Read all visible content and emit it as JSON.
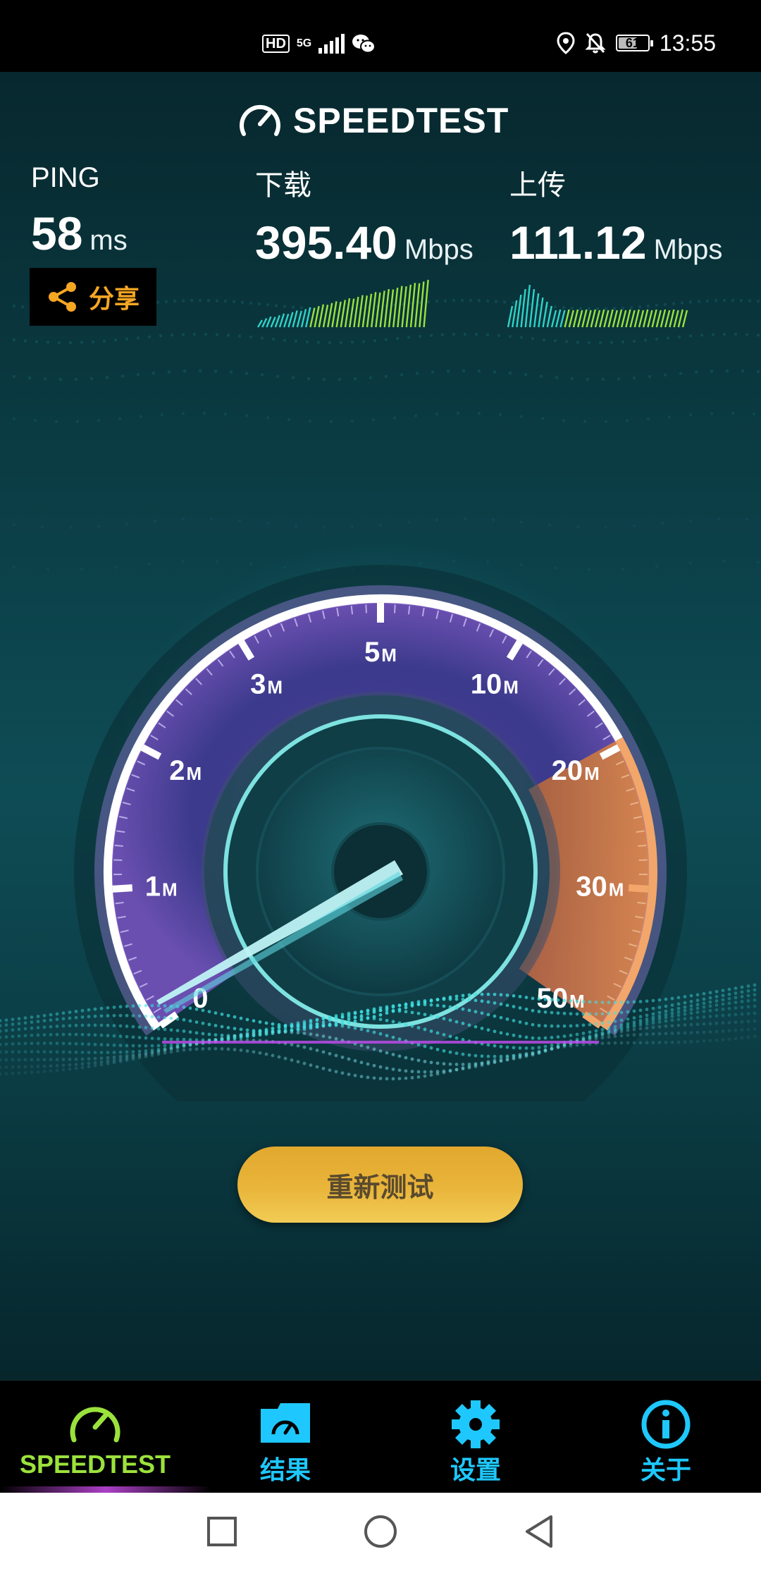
{
  "status_bar": {
    "hd": "HD",
    "network": "5G",
    "time": "13:55",
    "battery": "61"
  },
  "app": {
    "logo_text": "SPEEDTEST",
    "ping": {
      "label": "PING",
      "value": "58",
      "unit": "ms"
    },
    "download": {
      "label": "下载",
      "value": "395.40",
      "unit": "Mbps"
    },
    "upload": {
      "label": "上传",
      "value": "111.12",
      "unit": "Mbps"
    },
    "share_label": "分享",
    "gauge": {
      "labels": [
        {
          "num": "0",
          "unit": ""
        },
        {
          "num": "1",
          "unit": "M"
        },
        {
          "num": "2",
          "unit": "M"
        },
        {
          "num": "3",
          "unit": "M"
        },
        {
          "num": "5",
          "unit": "M"
        },
        {
          "num": "10",
          "unit": "M"
        },
        {
          "num": "20",
          "unit": "M"
        },
        {
          "num": "30",
          "unit": "M"
        },
        {
          "num": "50",
          "unit": "M"
        }
      ],
      "arc_color": "#ffffff",
      "face_color": "#2e3f86",
      "highlight_color": "#d9753a"
    },
    "retest_label": "重新测试"
  },
  "bottom_nav": {
    "items": [
      {
        "label": "SPEEDTEST",
        "icon": "speedometer-icon",
        "color": "#9be23c",
        "active": true
      },
      {
        "label": "结果",
        "icon": "results-folder-icon",
        "color": "#1ec8ff",
        "active": false
      },
      {
        "label": "设置",
        "icon": "gear-icon",
        "color": "#1ec8ff",
        "active": false
      },
      {
        "label": "关于",
        "icon": "info-icon",
        "color": "#1ec8ff",
        "active": false
      }
    ]
  },
  "system_nav": {
    "items": [
      "recents-square-icon",
      "home-circle-icon",
      "back-triangle-icon"
    ]
  }
}
